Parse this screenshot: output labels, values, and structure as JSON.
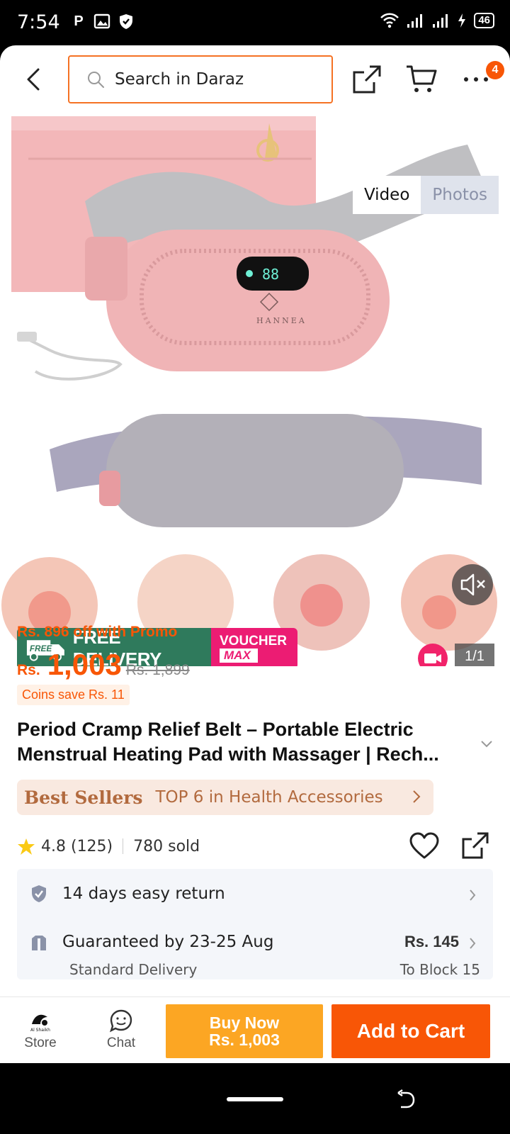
{
  "status_bar": {
    "time": "7:54",
    "battery": "46"
  },
  "header": {
    "search_placeholder": "Search in Daraz",
    "cart_count": "4"
  },
  "gallery": {
    "tab_video": "Video",
    "tab_photos": "Photos",
    "counter": "1/1",
    "brand_on_device": "HANNEA",
    "promo_free": "FREE DELIVERY",
    "promo_free_badge": "FREE",
    "promo_voucher_1": "VOUCHER",
    "promo_voucher_2": "MAX"
  },
  "price": {
    "promo_line": "Rs. 896 off with Promo",
    "currency": "Rs.",
    "value": "1,003",
    "old": "Rs. 1,899",
    "coins": "Coins save Rs. 11"
  },
  "product": {
    "title": "Period Cramp Relief Belt – Portable Electric Menstrual Heating Pad with Massager | Rech..."
  },
  "bestseller": {
    "badge": "Best Sellers",
    "text": "TOP 6 in Health Accessories"
  },
  "rating": {
    "value": "4.8 (125)",
    "sold": "780 sold"
  },
  "service": {
    "return_text": "14 days easy return",
    "delivery_text": "Guaranteed by 23-25 Aug",
    "delivery_sub": "Standard Delivery",
    "delivery_price": "Rs. 145",
    "delivery_dest": "To Block 15"
  },
  "bottom_bar": {
    "store": "Store",
    "chat": "Chat",
    "buy_now_1": "Buy Now",
    "buy_now_2": "Rs. 1,003",
    "add_to_cart": "Add to Cart"
  },
  "colors": {
    "accent": "#f85606",
    "search_border": "#f57224",
    "buy_now": "#fca623",
    "free_delivery": "#2f7a5c",
    "voucher": "#ec1c73"
  }
}
